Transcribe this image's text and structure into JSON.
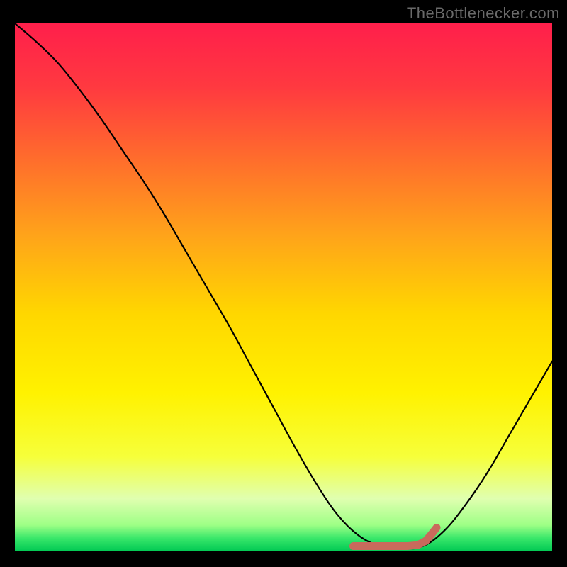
{
  "watermark": "TheBottlenecker.com",
  "chart_data": {
    "type": "line",
    "title": "",
    "xlabel": "",
    "ylabel": "",
    "xlim": [
      0,
      100
    ],
    "ylim": [
      0,
      100
    ],
    "grid": false,
    "series": [
      {
        "name": "bottleneck-curve",
        "x": [
          0,
          4,
          8,
          12,
          16,
          20,
          24,
          28,
          32,
          36,
          40,
          44,
          48,
          52,
          56,
          60,
          64,
          68,
          72,
          76,
          80,
          84,
          88,
          92,
          96,
          100
        ],
        "y": [
          100,
          96.5,
          92.5,
          87.5,
          82,
          76,
          70,
          63.5,
          56.5,
          49.5,
          42.5,
          35,
          27.5,
          20,
          13,
          7,
          3,
          1,
          0.5,
          1,
          4,
          9,
          15,
          22,
          29,
          36
        ]
      },
      {
        "name": "optimal-marker",
        "x": [
          63,
          65,
          67,
          69,
          71,
          73,
          75,
          76.5,
          77.5,
          78.5
        ],
        "y": [
          1.0,
          1.0,
          1.0,
          1.0,
          1.0,
          1.0,
          1.2,
          2.0,
          3.2,
          4.5
        ]
      }
    ],
    "gradient_stops": [
      {
        "offset": 0.0,
        "color": "#ff1f4b"
      },
      {
        "offset": 0.12,
        "color": "#ff3940"
      },
      {
        "offset": 0.25,
        "color": "#ff6a2d"
      },
      {
        "offset": 0.4,
        "color": "#ffa31a"
      },
      {
        "offset": 0.55,
        "color": "#ffd700"
      },
      {
        "offset": 0.7,
        "color": "#fff200"
      },
      {
        "offset": 0.82,
        "color": "#f6ff3a"
      },
      {
        "offset": 0.9,
        "color": "#e0ffb0"
      },
      {
        "offset": 0.95,
        "color": "#9eff86"
      },
      {
        "offset": 0.975,
        "color": "#39e76a"
      },
      {
        "offset": 1.0,
        "color": "#00c853"
      }
    ],
    "curve_color": "#000000",
    "marker_color": "#c96a5c"
  }
}
